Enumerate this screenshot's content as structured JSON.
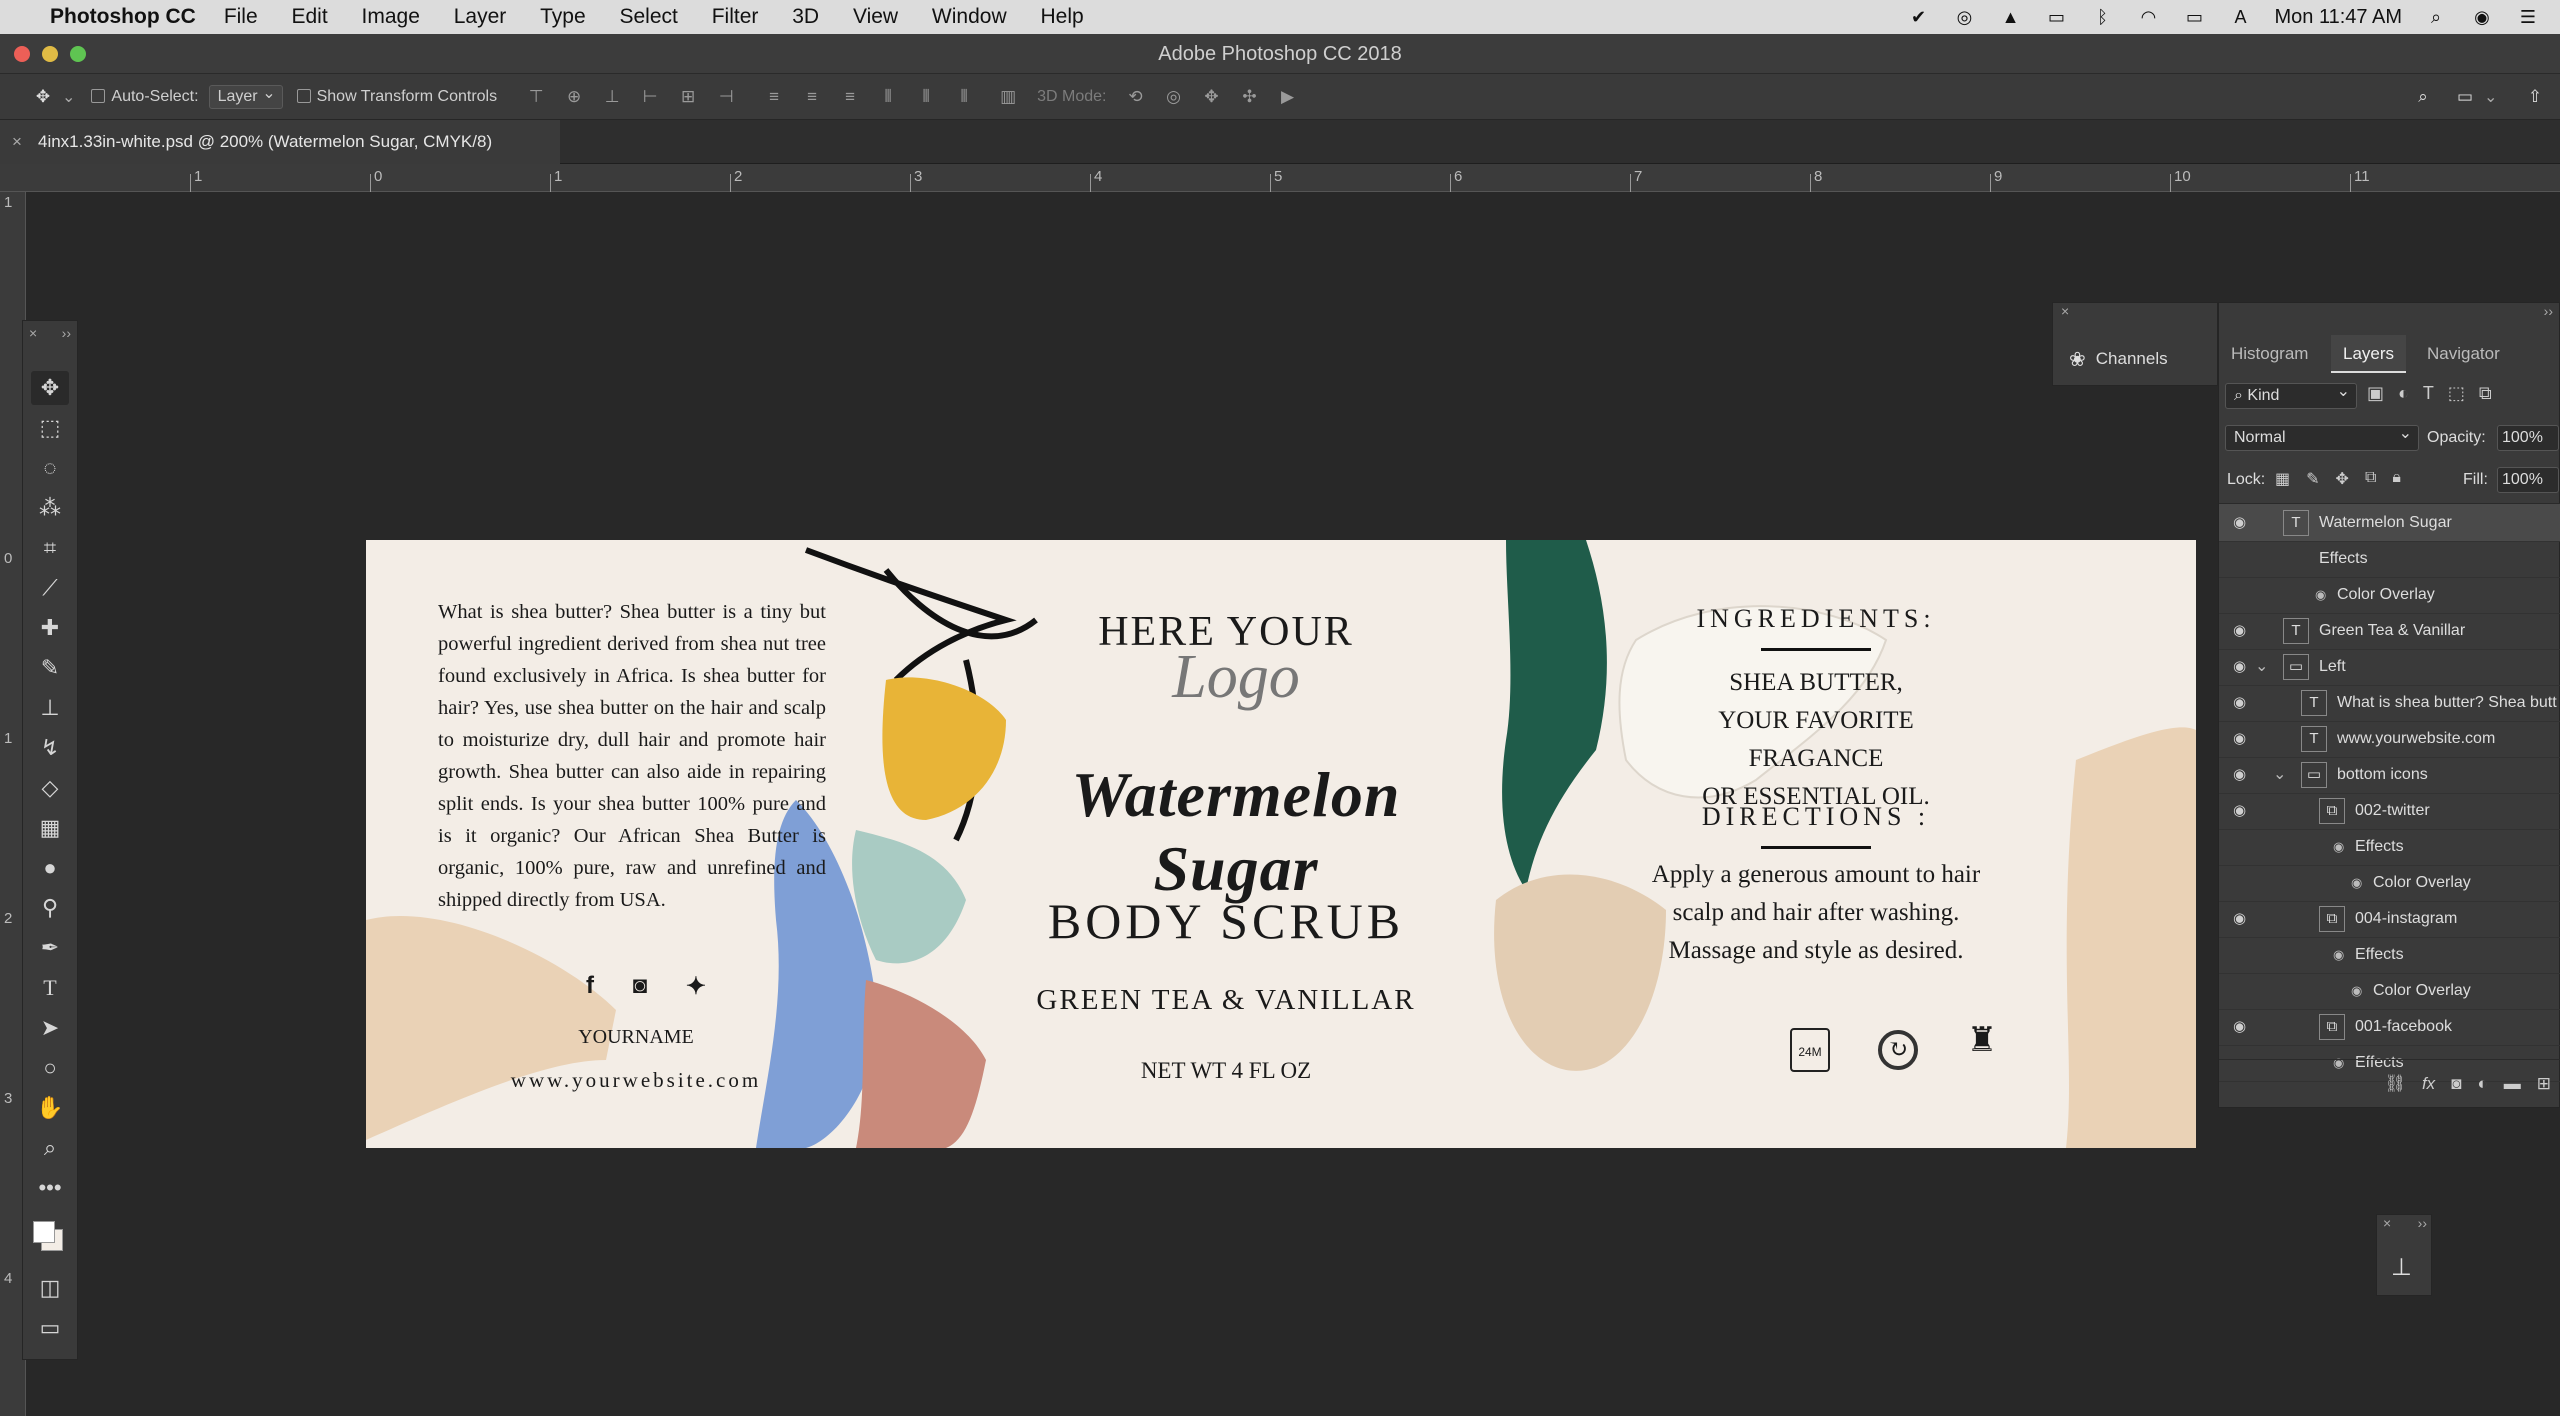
{
  "menubar": {
    "app_name": "Photoshop CC",
    "menus": [
      "File",
      "Edit",
      "Image",
      "Layer",
      "Type",
      "Select",
      "Filter",
      "3D",
      "View",
      "Window",
      "Help"
    ],
    "clock": "Mon 11:47 AM"
  },
  "window": {
    "title": "Adobe Photoshop CC 2018"
  },
  "options": {
    "auto_select_label": "Auto-Select:",
    "auto_select_value": "Layer",
    "transform_label": "Show Transform Controls",
    "mode_3d_label": "3D Mode:"
  },
  "document": {
    "tab_title": "4inx1.33in-white.psd @ 200% (Watermelon Sugar, CMYK/8)"
  },
  "ruler": {
    "h_ticks": [
      "1",
      "0",
      "1",
      "2",
      "3",
      "4",
      "5",
      "6",
      "7",
      "8",
      "9",
      "10",
      "11"
    ],
    "v_ticks": [
      "1",
      "0",
      "1",
      "2",
      "3",
      "4"
    ]
  },
  "label": {
    "paragraph": "What is shea butter? Shea butter is a tiny but powerful ingredient derived from shea nut tree found exclusively in Africa. Is shea butter for hair? Yes, use shea butter on the hair and scalp to moisturize dry, dull hair and promote hair growth. Shea butter can also aide in repairing split ends. Is your shea butter 100% pure and is it organic? Our African Shea Butter is organic, 100% pure, raw and unrefined and shipped directly from USA.",
    "username": "YOURNAME",
    "website": "www.yourwebsite.com",
    "logo_top": "HERE YOUR",
    "logo_script": "Logo",
    "product_name": "Watermelon Sugar",
    "product_type": "BODY SCRUB",
    "flavor": "GREEN TEA & VANILLAR",
    "net_weight": "NET WT 4 FL OZ",
    "ingredients_heading": "INGREDIENTS:",
    "ingredients_lines": [
      "SHEA BUTTER,",
      "YOUR FAVORITE FRAGANCE",
      "OR ESSENTIAL OIL."
    ],
    "directions_heading": "DIRECTIONS :",
    "directions_lines": [
      "Apply a generous amount to hair",
      "scalp and hair after washing.",
      "Massage and style as desired."
    ],
    "badge_24m": "24M"
  },
  "panels": {
    "channels_label": "Channels",
    "tabs": [
      "Histogram",
      "Layers",
      "Navigator"
    ],
    "filter_kind": "Kind",
    "blend_mode": "Normal",
    "opacity_label": "Opacity:",
    "opacity_value": "100%",
    "lock_label": "Lock:",
    "fill_label": "Fill:",
    "fill_value": "100%",
    "layers": [
      {
        "name": "Watermelon Sugar",
        "indent": 0,
        "kind": "text",
        "eye": true
      },
      {
        "name": "Effects",
        "indent": 1,
        "kind": "fx",
        "eye": false
      },
      {
        "name": "Color Overlay",
        "indent": 2,
        "kind": "fx",
        "eye": true
      },
      {
        "name": "Green Tea & Vanillar",
        "indent": 0,
        "kind": "text",
        "eye": true
      },
      {
        "name": "Left",
        "indent": 0,
        "kind": "folder",
        "eye": true
      },
      {
        "name": "What is shea butter? Shea butt",
        "indent": 1,
        "kind": "text",
        "eye": true
      },
      {
        "name": "www.yourwebsite.com",
        "indent": 1,
        "kind": "text",
        "eye": true
      },
      {
        "name": "bottom icons",
        "indent": 1,
        "kind": "folder",
        "eye": true
      },
      {
        "name": "002-twitter",
        "indent": 2,
        "kind": "smart",
        "eye": true
      },
      {
        "name": "Effects",
        "indent": 3,
        "kind": "fx",
        "eye": true
      },
      {
        "name": "Color Overlay",
        "indent": 4,
        "kind": "fx",
        "eye": true
      },
      {
        "name": "004-instagram",
        "indent": 2,
        "kind": "smart",
        "eye": true
      },
      {
        "name": "Effects",
        "indent": 3,
        "kind": "fx",
        "eye": true
      },
      {
        "name": "Color Overlay",
        "indent": 4,
        "kind": "fx",
        "eye": true
      },
      {
        "name": "001-facebook",
        "indent": 2,
        "kind": "smart",
        "eye": true
      },
      {
        "name": "Effects",
        "indent": 3,
        "kind": "fx",
        "eye": true
      }
    ]
  },
  "colors": {
    "accent_tab": "#f0f0f0",
    "paint_green": "#1f5c4a",
    "paint_yellow": "#e8b437",
    "paint_blue": "#7f9fd6",
    "paint_mint": "#a9cbc3",
    "paint_rose": "#c98a7b",
    "paint_beige": "#ead2b6"
  }
}
